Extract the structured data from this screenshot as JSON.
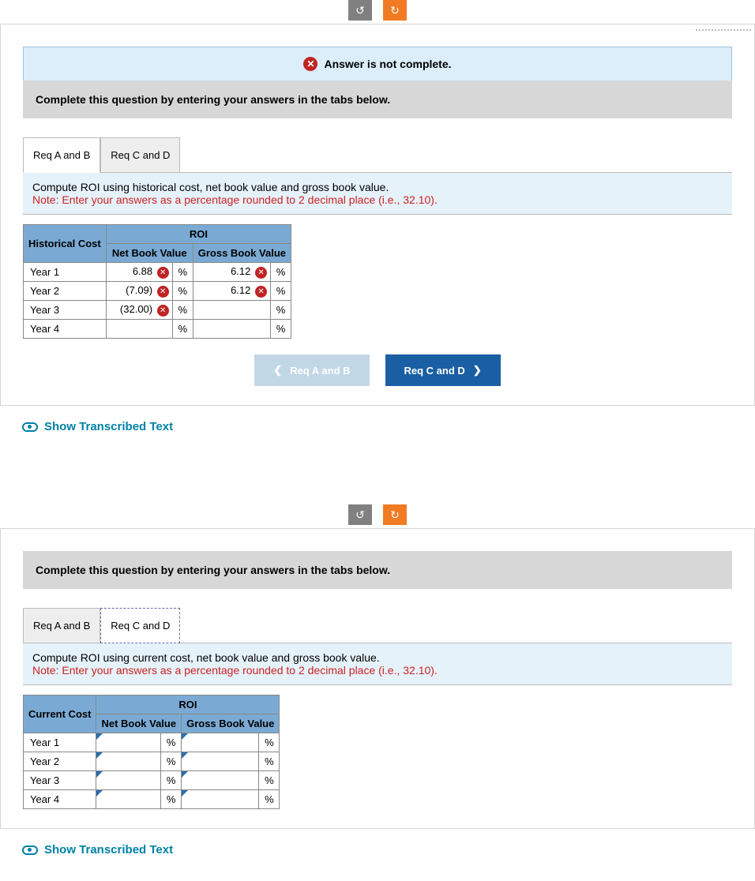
{
  "top": {
    "status_text": "Answer is not complete.",
    "instruction": "Complete this question by entering your answers in the tabs below.",
    "tabs": [
      "Req A and B",
      "Req C and D"
    ],
    "prompt_line1": "Compute ROI using historical cost, net book value and gross book value.",
    "prompt_note": "Note: Enter your answers as a percentage rounded to 2 decimal place (i.e., 32.10).",
    "table": {
      "corner": "Historical Cost",
      "roi": "ROI",
      "col1": "Net Book Value",
      "col2": "Gross Book Value",
      "pct": "%",
      "rows": [
        {
          "label": "Year 1",
          "nbv": "6.88",
          "nbv_wrong": true,
          "gbv": "6.12",
          "gbv_wrong": true
        },
        {
          "label": "Year 2",
          "nbv": "(7.09)",
          "nbv_wrong": true,
          "gbv": "6.12",
          "gbv_wrong": true
        },
        {
          "label": "Year 3",
          "nbv": "(32.00)",
          "nbv_wrong": true,
          "gbv": "",
          "gbv_wrong": false
        },
        {
          "label": "Year 4",
          "nbv": "",
          "nbv_wrong": false,
          "gbv": "",
          "gbv_wrong": false
        }
      ]
    },
    "nav_prev": "Req A and B",
    "nav_next": "Req C and D"
  },
  "show_transcribed": "Show Transcribed Text",
  "bottom": {
    "instruction": "Complete this question by entering your answers in the tabs below.",
    "tabs": [
      "Req A and B",
      "Req C and D"
    ],
    "prompt_line1": "Compute ROI using current cost, net book value and gross book value.",
    "prompt_note": "Note: Enter your answers as a percentage rounded to 2 decimal place (i.e., 32.10).",
    "table": {
      "corner": "Current Cost",
      "roi": "ROI",
      "col1": "Net Book Value",
      "col2": "Gross Book Value",
      "pct": "%",
      "rows": [
        {
          "label": "Year 1"
        },
        {
          "label": "Year 2"
        },
        {
          "label": "Year 3"
        },
        {
          "label": "Year 4"
        }
      ]
    }
  }
}
